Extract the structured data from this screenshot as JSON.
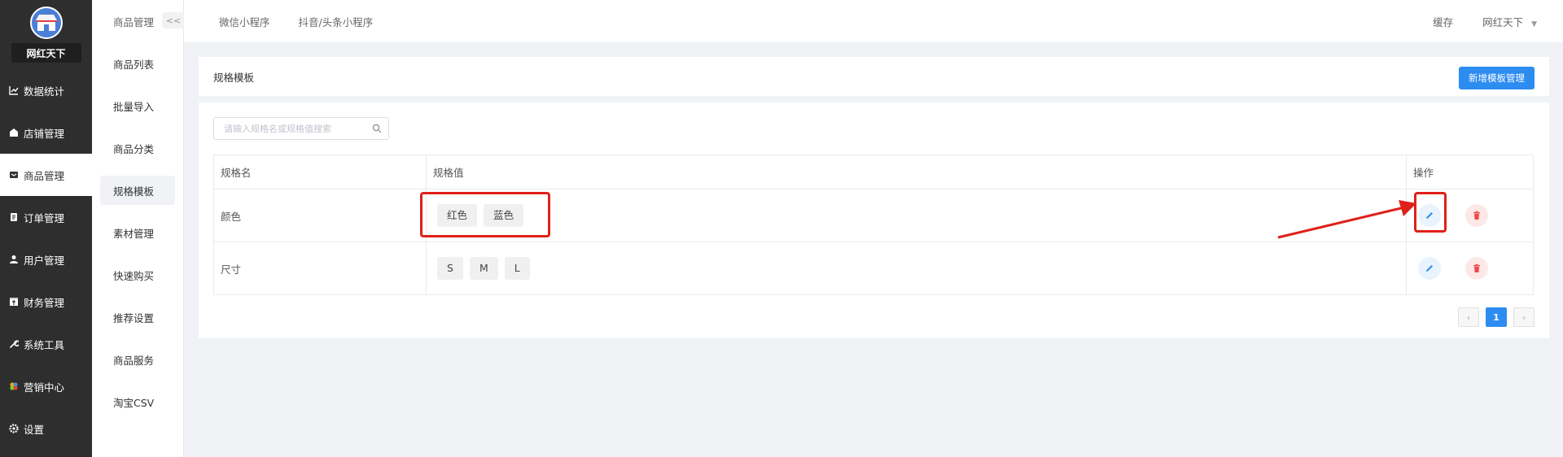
{
  "sidebar": {
    "shop_name": "网红天下",
    "items": [
      {
        "label": "数据统计",
        "icon": "chart-line-icon"
      },
      {
        "label": "店铺管理",
        "icon": "store-icon"
      },
      {
        "label": "商品管理",
        "icon": "goods-icon",
        "active": true
      },
      {
        "label": "订单管理",
        "icon": "order-icon"
      },
      {
        "label": "用户管理",
        "icon": "user-icon"
      },
      {
        "label": "财务管理",
        "icon": "finance-icon"
      },
      {
        "label": "系统工具",
        "icon": "wrench-icon"
      },
      {
        "label": "营销中心",
        "icon": "marketing-icon"
      },
      {
        "label": "设置",
        "icon": "gear-icon"
      }
    ]
  },
  "submenu": {
    "title": "商品管理",
    "collapse_label": "<<",
    "items": [
      {
        "label": "商品列表"
      },
      {
        "label": "批量导入"
      },
      {
        "label": "商品分类"
      },
      {
        "label": "规格模板",
        "active": true
      },
      {
        "label": "素材管理"
      },
      {
        "label": "快速购买"
      },
      {
        "label": "推荐设置"
      },
      {
        "label": "商品服务"
      },
      {
        "label": "淘宝CSV"
      }
    ]
  },
  "topbar": {
    "tabs": [
      "微信小程序",
      "抖音/头条小程序"
    ],
    "cache_label": "缓存",
    "user_label": "网红天下"
  },
  "page": {
    "title": "规格模板",
    "add_button": "新增模板管理"
  },
  "search": {
    "placeholder": "请输入规格名或规格值搜索"
  },
  "table": {
    "headers": [
      "规格名",
      "规格值",
      "操作"
    ],
    "rows": [
      {
        "name": "颜色",
        "values": [
          "红色",
          "蓝色"
        ]
      },
      {
        "name": "尺寸",
        "values": [
          "S",
          "M",
          "L"
        ]
      }
    ]
  },
  "pagination": {
    "prev": "‹",
    "current": "1",
    "next": "›"
  },
  "colors": {
    "primary": "#2d8cf0",
    "sidebar_bg": "#2e2e2e",
    "annotation_red": "#e0201a"
  }
}
